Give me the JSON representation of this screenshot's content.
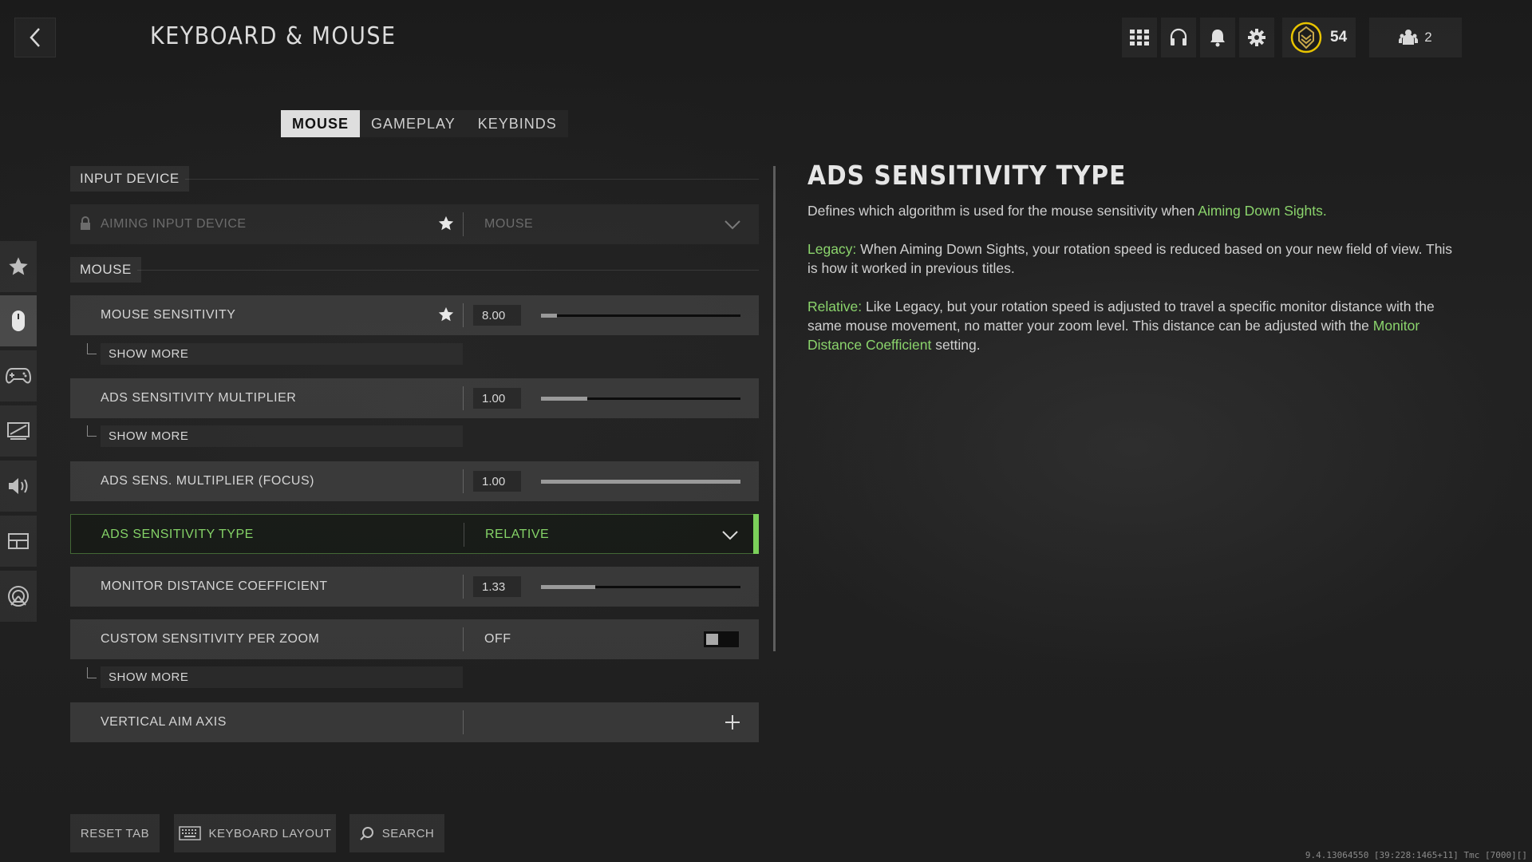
{
  "header": {
    "title": "KEYBOARD & MOUSE",
    "rank_level": "54",
    "party_count": "2"
  },
  "tabs": [
    {
      "label": "MOUSE",
      "active": true
    },
    {
      "label": "GAMEPLAY",
      "active": false
    },
    {
      "label": "KEYBINDS",
      "active": false
    }
  ],
  "left_rail": [
    {
      "icon": "star-icon"
    },
    {
      "icon": "mouse-icon",
      "active": true
    },
    {
      "icon": "controller-icon"
    },
    {
      "icon": "display-icon"
    },
    {
      "icon": "speaker-icon"
    },
    {
      "icon": "interface-icon"
    },
    {
      "icon": "network-icon"
    }
  ],
  "sections": {
    "input_device": "INPUT DEVICE",
    "mouse": "MOUSE"
  },
  "rows": {
    "aiming_input_device": {
      "label": "AIMING INPUT DEVICE",
      "value": "MOUSE",
      "locked": true
    },
    "mouse_sensitivity": {
      "label": "MOUSE SENSITIVITY",
      "value": "8.00",
      "slider": 0.08
    },
    "ads_sens_multiplier": {
      "label": "ADS SENSITIVITY MULTIPLIER",
      "value": "1.00",
      "slider": 0.23
    },
    "ads_sens_multiplier_focus": {
      "label": "ADS SENS. MULTIPLIER (FOCUS)",
      "value": "1.00",
      "slider": 1.0
    },
    "ads_sensitivity_type": {
      "label": "ADS SENSITIVITY TYPE",
      "value": "RELATIVE"
    },
    "monitor_distance_coefficient": {
      "label": "MONITOR DISTANCE COEFFICIENT",
      "value": "1.33",
      "slider": 0.27
    },
    "custom_sens_per_zoom": {
      "label": "CUSTOM SENSITIVITY PER ZOOM",
      "value": "OFF"
    },
    "vertical_aim_axis": {
      "label": "VERTICAL AIM AXIS"
    }
  },
  "show_more_label": "SHOW MORE",
  "description": {
    "title": "ADS SENSITIVITY TYPE",
    "p1_text": "Defines which algorithm is used for the mouse sensitivity when",
    "p1_link": "Aiming Down Sights.",
    "p2_lead": "Legacy:",
    "p2_text": "When Aiming Down Sights, your rotation speed is reduced based on your new field of view. This is how it worked in previous titles.",
    "p3_lead": "Relative:",
    "p3_text": "Like Legacy, but your rotation speed is adjusted to travel a specific monitor distance with the same mouse movement, no matter your zoom level. This distance can be adjusted with the",
    "p3_link": "Monitor Distance Coefficient",
    "p3_tail": "setting."
  },
  "bottom": {
    "reset_tab": "RESET TAB",
    "keyboard_layout": "KEYBOARD LAYOUT",
    "search": "SEARCH"
  },
  "version": "9.4.13064550 [39:228:1465+11] Tmc [7000][]",
  "colors": {
    "accent_green": "#7bd05a",
    "link_green": "#8bd46c",
    "rank_yellow": "#e8c400"
  }
}
